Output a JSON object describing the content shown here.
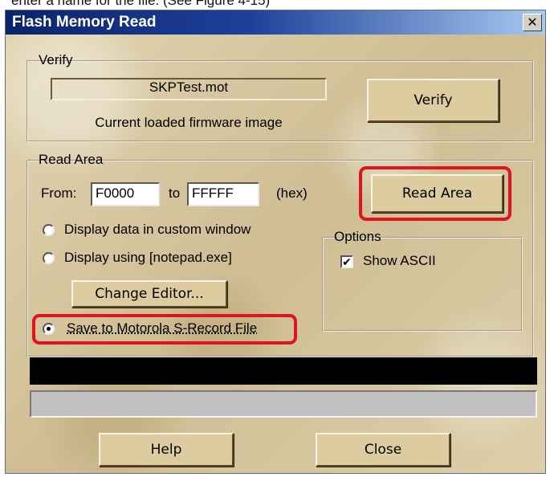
{
  "caption_partial": "enter a name for the file. (See Figure 4-15)",
  "window": {
    "title": "Flash Memory Read",
    "close_symbol": "✕"
  },
  "verify": {
    "legend": "Verify",
    "filename": "SKPTest.mot",
    "caption": "Current loaded firmware image",
    "button": "Verify"
  },
  "read_area": {
    "legend": "Read Area",
    "from_label": "From:",
    "from_value": "F0000",
    "to_label": "to",
    "to_value": "FFFFF",
    "hex_label": "(hex)",
    "read_button": "Read Area",
    "radio_custom": "Display data in custom window",
    "radio_notepad": "Display using [notepad.exe]",
    "change_editor": "Change Editor...",
    "radio_srecord": "Save to Motorola S-Record File",
    "selected_radio": "srecord"
  },
  "options": {
    "legend": "Options",
    "show_ascii_label": "Show ASCII",
    "show_ascii_checked": true,
    "check_symbol": "✔"
  },
  "status": {
    "bar_color": "#000000",
    "progress_color": "#c0c0c0"
  },
  "footer": {
    "help": "Help",
    "close": "Close"
  },
  "colors": {
    "highlight": "#e0141e",
    "titlebar_start": "#0a246a",
    "titlebar_end": "#a6caf0"
  }
}
